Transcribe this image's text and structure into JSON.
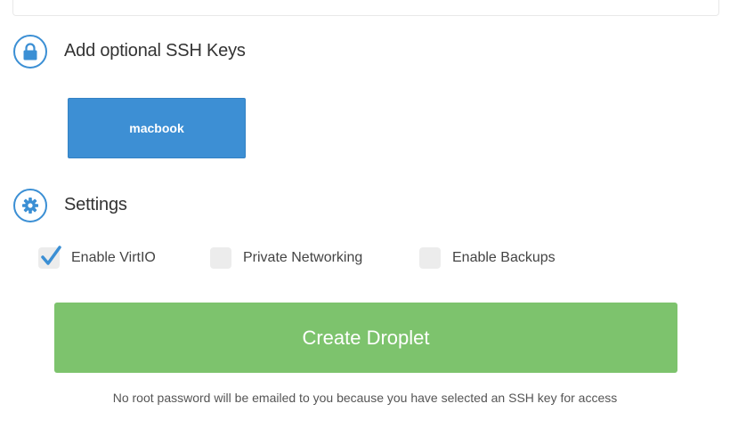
{
  "ssh_section": {
    "title": "Add optional SSH Keys",
    "icon": "lock-icon",
    "keys": [
      {
        "label": "macbook",
        "selected": true
      }
    ]
  },
  "settings_section": {
    "title": "Settings",
    "icon": "gear-icon",
    "options": [
      {
        "label": "Enable VirtIO",
        "checked": true
      },
      {
        "label": "Private Networking",
        "checked": false
      },
      {
        "label": "Enable Backups",
        "checked": false
      }
    ]
  },
  "create_button": {
    "label": "Create Droplet"
  },
  "note": "No root password will be emailed to you because you have selected an SSH key for access",
  "colors": {
    "accent": "#3d8fd4",
    "success": "#7dc36d",
    "checkbox_bg": "#ececec"
  }
}
